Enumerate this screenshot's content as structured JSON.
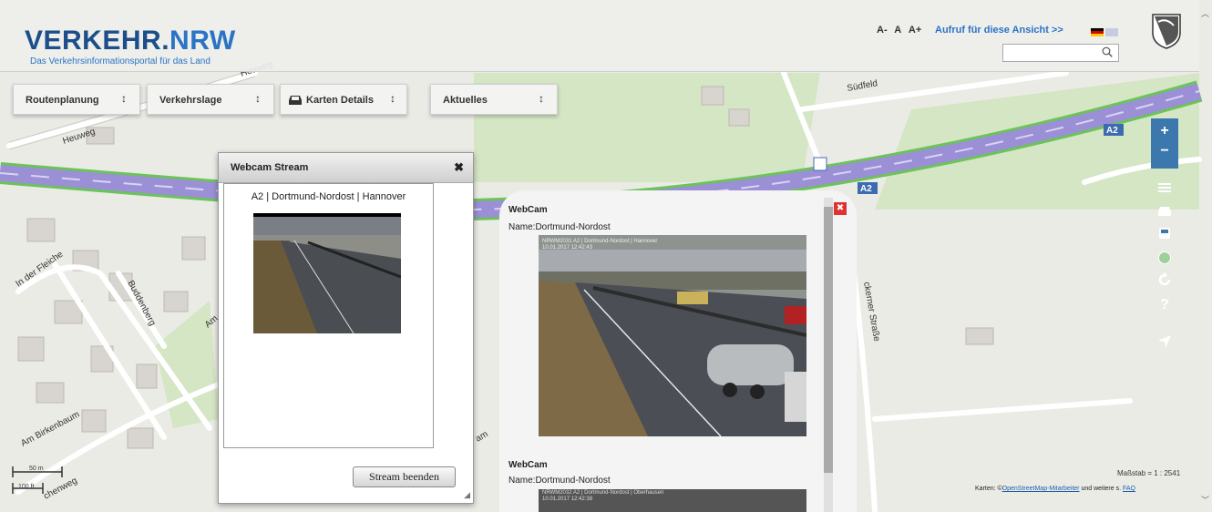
{
  "header": {
    "logo_main": "VERKEHR.",
    "logo_nrw": "NRW",
    "logo_sub": "Das Verkehrsinformationsportal für das Land",
    "font_size": [
      "A-",
      "A",
      "A+"
    ],
    "view_link": "Aufruf für diese Ansicht >>"
  },
  "nav": [
    {
      "label": "Routenplanung",
      "arrow": "↕"
    },
    {
      "label": "Verkehrslage",
      "arrow": "↕"
    },
    {
      "label": "Karten Details",
      "arrow": "↕"
    },
    {
      "label": "Aktuelles",
      "arrow": "↕"
    }
  ],
  "map": {
    "streets": [
      "Heuweg",
      "Heuweg",
      "Südfeld",
      "In der Fleiche",
      "Buddenberg",
      "Am",
      "Am Birkenbaum",
      "chenweg",
      "ckerner Straße",
      "am"
    ],
    "road_shields": [
      "A2",
      "A2"
    ]
  },
  "map_controls": {
    "zoom_in": "+",
    "zoom_out": "−",
    "help": "?"
  },
  "scale": {
    "bar_small": "50 m",
    "bar_large": "100 ft",
    "text": "Maßstab = 1 : 2541"
  },
  "attribution": {
    "prefix": "Karten: ©",
    "link": "OpenStreetMap-Mitarbeiter",
    "suffix": "und weitere s.",
    "faq": "FAQ"
  },
  "webcam_stream": {
    "title": "Webcam Stream",
    "close": "✖",
    "caption": "A2 | Dortmund-Nordost | Hannover",
    "stop_button": "Stream beenden"
  },
  "webcam_panel": {
    "close": "✖",
    "entries": [
      {
        "heading": "WebCam",
        "name": "Name:Dortmund-Nordost",
        "cam_caption": "NRWM2031 A2 | Dortmund-Nordost | Hannover",
        "cam_time": "10.01.2017 12:42:43"
      },
      {
        "heading": "WebCam",
        "name": "Name:Dortmund-Nordost",
        "cam_caption": "NRWM2032 A2 | Dortmund-Nordost | Oberhausen",
        "cam_time": "10.01.2017 12:42:38"
      }
    ]
  },
  "colors": {
    "brand_dark": "#1c4e8a",
    "brand_light": "#2a74c5",
    "control_blue": "#3c78ad",
    "highway": "#9b8fd6",
    "highway_edge": "#6cc35a"
  }
}
